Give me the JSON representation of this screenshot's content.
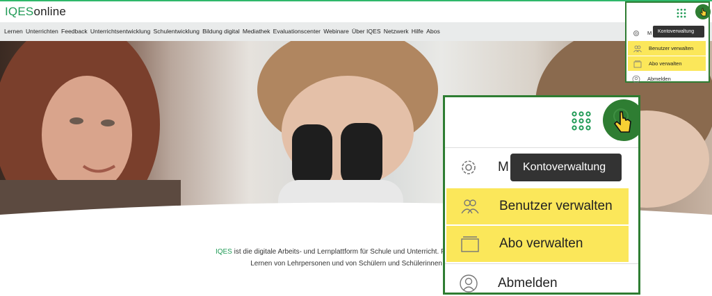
{
  "logo": {
    "part1": "IQES",
    "part2": "online"
  },
  "nav": {
    "items": [
      "Lernen",
      "Unterrichten",
      "Feedback",
      "Unterrichtsentwicklung",
      "Schulentwicklung",
      "Bildung digital",
      "Mediathek",
      "Evaluationscenter",
      "Webinare",
      "Über IQES",
      "Netzwerk",
      "Hilfe",
      "Abos"
    ]
  },
  "intro": {
    "brand": "IQES",
    "line1_rest": " ist die digitale Arbeits- und Lernplattform für Schule und Unterricht. Praxisorientiert, in",
    "line2": "Lernen von Lehrpersonen und von Schülern und Schülerinnen in der"
  },
  "account_menu": {
    "tooltip": "Kontoverwaltung",
    "first_item_partial": "M",
    "items": [
      {
        "label": "Benutzer verwalten",
        "icon": "users-icon",
        "highlighted": true
      },
      {
        "label": "Abo verwalten",
        "icon": "folder-icon",
        "highlighted": true
      },
      {
        "label": "Abmelden",
        "icon": "user-circle-icon",
        "highlighted": false
      }
    ]
  },
  "colors": {
    "brand_green": "#1f9a55",
    "avatar_green": "#2e7d32",
    "highlight_yellow": "#fbe75a",
    "nav_bg": "#e9ebeb"
  }
}
